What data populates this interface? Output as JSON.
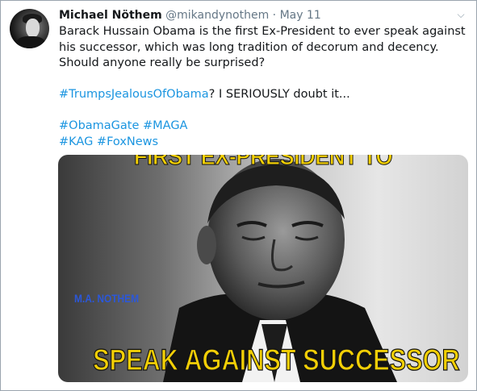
{
  "tweet": {
    "author_name": "Michael Nöthem",
    "handle": "@mikandynothem",
    "separator": " · ",
    "date": "May 11",
    "caret_icon": "chevron-down-icon",
    "lines": {
      "l1": "Barack Hussain Obama is the first Ex-President to ever speak against",
      "l2": "his successor, which was long tradition of decorum and decency.",
      "l3": "Should anyone really be surprised?",
      "l5_tag": "#TrumpsJealousOfObama",
      "l5_rest": "? I SERIOUSLY doubt it...",
      "l7_tag1": "#ObamaGate",
      "l7_tag2": "#MAGA",
      "l8_tag1": "#KAG",
      "l8_tag2": "#FoxNews"
    }
  },
  "media": {
    "top_text": "FIRST EX-PRESIDENT TO",
    "watermark": "M.A. NOTHEM",
    "caption": "SPEAK AGAINST SUCCESSOR",
    "caption_color": "#f2cf06",
    "watermark_color": "#2b57d9"
  },
  "colors": {
    "link": "#1b95e0",
    "meta": "#657786",
    "text": "#14171a"
  }
}
